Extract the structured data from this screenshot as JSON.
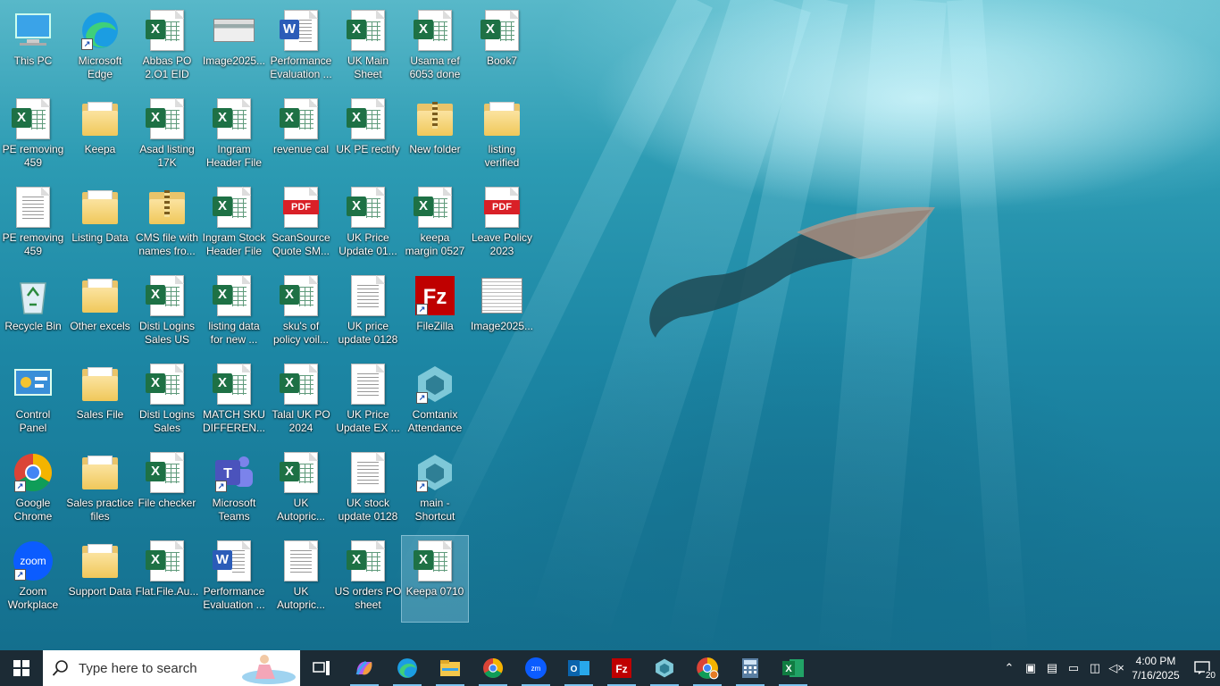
{
  "desktop": {
    "icons": [
      {
        "label": "This PC",
        "type": "pc"
      },
      {
        "label": "Microsoft\nEdge",
        "type": "edge",
        "shortcut": true
      },
      {
        "label": "Abbas PO\n2.O1  EID",
        "type": "excel"
      },
      {
        "label": "Image2025...",
        "type": "image"
      },
      {
        "label": "Performance\nEvaluation ...",
        "type": "word"
      },
      {
        "label": "UK Main\nSheet",
        "type": "excel"
      },
      {
        "label": "Usama ref\n6053 done",
        "type": "excel"
      },
      {
        "label": "Book7",
        "type": "excel"
      },
      {
        "label": "PE removing\n459",
        "type": "excel"
      },
      {
        "label": "Keepa",
        "type": "folder"
      },
      {
        "label": "Asad listing\n17K",
        "type": "excel"
      },
      {
        "label": "Ingram\nHeader File",
        "type": "excel"
      },
      {
        "label": "revenue cal",
        "type": "excel"
      },
      {
        "label": "UK PE rectify",
        "type": "excel"
      },
      {
        "label": "New folder",
        "type": "zipfolder"
      },
      {
        "label": "listing\nverified",
        "type": "folder"
      },
      {
        "label": "PE removing\n459",
        "type": "text"
      },
      {
        "label": "Listing Data",
        "type": "folder"
      },
      {
        "label": "CMS file with\nnames fro...",
        "type": "zipfolder"
      },
      {
        "label": "Ingram Stock\nHeader File",
        "type": "excel"
      },
      {
        "label": "ScanSource\nQuote SM...",
        "type": "pdf"
      },
      {
        "label": "UK Price\nUpdate 01...",
        "type": "excel"
      },
      {
        "label": "keepa\nmargin 0527",
        "type": "excel"
      },
      {
        "label": "Leave Policy\n2023",
        "type": "pdf"
      },
      {
        "label": "Recycle Bin",
        "type": "recycle"
      },
      {
        "label": "Other excels",
        "type": "folder"
      },
      {
        "label": "Disti Logins\nSales US",
        "type": "excel"
      },
      {
        "label": "listing data\nfor new ...",
        "type": "excel"
      },
      {
        "label": "sku's of\npolicy voil...",
        "type": "excel"
      },
      {
        "label": "UK price\nupdate 0128",
        "type": "text"
      },
      {
        "label": "FileZilla",
        "type": "filezilla",
        "shortcut": true
      },
      {
        "label": "Image2025...",
        "type": "image2"
      },
      {
        "label": "Control\nPanel",
        "type": "control"
      },
      {
        "label": "Sales File",
        "type": "folder"
      },
      {
        "label": "Disti Logins\nSales",
        "type": "excel"
      },
      {
        "label": "MATCH SKU\nDIFFEREN...",
        "type": "excel"
      },
      {
        "label": "Talal UK PO\n2024",
        "type": "excel"
      },
      {
        "label": "UK Price\nUpdate EX ...",
        "type": "text"
      },
      {
        "label": "Comtanix\nAttendance",
        "type": "comtanix",
        "shortcut": true
      },
      {
        "label": "Google\nChrome",
        "type": "chrome",
        "shortcut": true
      },
      {
        "label": "Sales practice\nfiles",
        "type": "folder"
      },
      {
        "label": "File checker",
        "type": "excel"
      },
      {
        "label": "Microsoft\nTeams",
        "type": "teams",
        "shortcut": true
      },
      {
        "label": "UK\nAutopric...",
        "type": "excel"
      },
      {
        "label": "UK stock\nupdate 0128",
        "type": "text"
      },
      {
        "label": "main -\nShortcut",
        "type": "comtanix",
        "shortcut": true
      },
      {
        "label": "Zoom\nWorkplace",
        "type": "zoom",
        "shortcut": true
      },
      {
        "label": "Support Data",
        "type": "folder"
      },
      {
        "label": "Flat.File.Au...",
        "type": "excel"
      },
      {
        "label": "Performance\nEvaluation ...",
        "type": "word"
      },
      {
        "label": "UK\nAutopric...",
        "type": "text"
      },
      {
        "label": "US orders PO\nsheet",
        "type": "excel"
      },
      {
        "label": "Keepa 0710",
        "type": "excel",
        "selected": true
      }
    ]
  },
  "taskbar": {
    "search_placeholder": "Type here to search",
    "apps": [
      "task-view-icon",
      "copilot-icon",
      "edge-icon",
      "file-explorer-icon",
      "chrome-icon",
      "zoom-icon",
      "outlook-icon",
      "filezilla-icon",
      "comtanix-icon",
      "chrome-profile-icon",
      "calculator-icon",
      "excel-icon"
    ],
    "time": "4:00 PM",
    "date": "7/16/2025",
    "notification_count": "20"
  }
}
